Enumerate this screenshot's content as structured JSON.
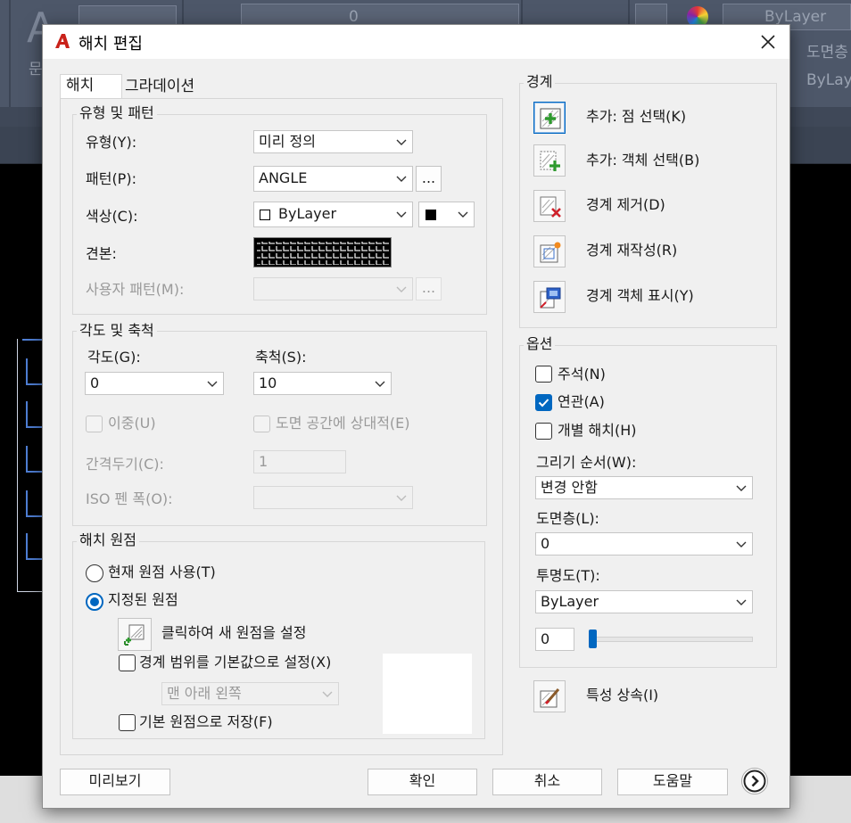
{
  "background_app": {
    "layer_value": "0",
    "bylayer_1": "ByLayer",
    "layer_hint": "도면층",
    "bylayer_2": "ByLayer",
    "left_glyph": "A",
    "left_glyph_sub": "문"
  },
  "dialog": {
    "title": "해치 편집",
    "tabs": [
      "해치",
      "그라데이션"
    ],
    "type_pattern": {
      "group_label": "유형 및 패턴",
      "type_label": "유형(Y):",
      "type_value": "미리 정의",
      "pattern_label": "패턴(P):",
      "pattern_value": "ANGLE",
      "browse_label": "...",
      "color_label": "색상(C):",
      "color_value": "ByLayer",
      "sample_label": "견본:",
      "custom_label": "사용자 패턴(M):",
      "custom_browse_label": "..."
    },
    "angle_scale": {
      "group_label": "각도 및 축척",
      "angle_label": "각도(G):",
      "angle_value": "0",
      "scale_label": "축척(S):",
      "scale_value": "10",
      "double_label": "이중(U)",
      "paper_space_label": "도면 공간에 상대적(E)",
      "spacing_label": "간격두기(C):",
      "spacing_value": "1",
      "iso_label": "ISO 펜 폭(O):"
    },
    "origin": {
      "group_label": "해치 원점",
      "use_current_label": "현재 원점 사용(T)",
      "specified_label": "지정된 원점",
      "click_set_label": "클릭하여 새 원점을 설정",
      "default_extents_label": "경계 범위를 기본값으로 설정(X)",
      "position_value": "맨 아래 왼쪽",
      "store_default_label": "기본 원점으로 저장(F)"
    },
    "boundaries": {
      "group_label": "경계",
      "add_pick_label": "추가: 점 선택(K)",
      "add_select_label": "추가: 객체 선택(B)",
      "remove_label": "경계 제거(D)",
      "recreate_label": "경계 재작성(R)",
      "view_label": "경계 객체 표시(Y)"
    },
    "options": {
      "group_label": "옵션",
      "annotative_label": "주석(N)",
      "associative_label": "연관(A)",
      "separate_label": "개별 해치(H)",
      "draw_order_label": "그리기 순서(W):",
      "draw_order_value": "변경 안함",
      "layer_label": "도면층(L):",
      "layer_value": "0",
      "transparency_label": "투명도(T):",
      "transparency_value": "ByLayer",
      "slider_value": "0",
      "annotative_checked": false,
      "associative_checked": true,
      "separate_checked": false
    },
    "inherit_label": "특성 상속(I)",
    "footer": {
      "preview_label": "미리보기",
      "ok_label": "확인",
      "cancel_label": "취소",
      "help_label": "도움말"
    }
  },
  "colors": {
    "accent": "#0067c0",
    "autocad_red": "#c9221a",
    "hatch_swatch": "#000000"
  }
}
